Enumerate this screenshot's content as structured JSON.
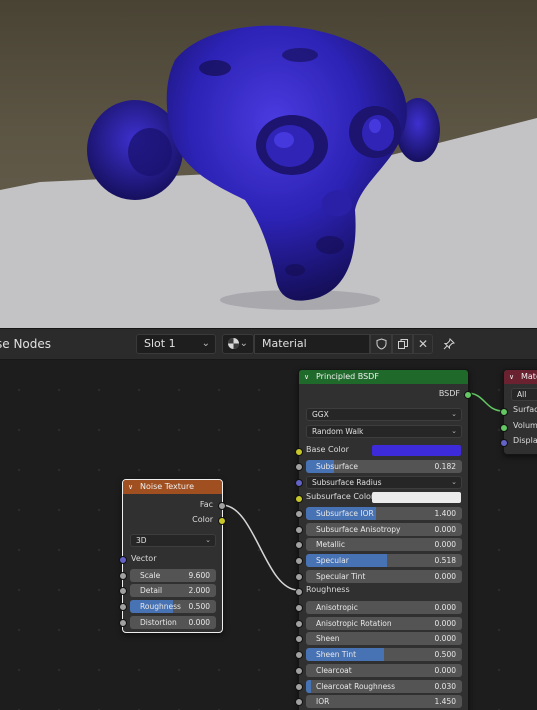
{
  "header": {
    "editor_title": "se Nodes",
    "slot": "Slot 1",
    "material_name": "Material",
    "icons": [
      "material-sphere-icon",
      "shield-icon",
      "duplicate-icon",
      "close-icon",
      "pin-icon"
    ]
  },
  "noise_node": {
    "title": "Noise Texture",
    "outputs": {
      "fac": "Fac",
      "color": "Color"
    },
    "dimensions": "3D",
    "vector_label": "Vector",
    "fields": [
      {
        "label": "Scale",
        "value": "9.600",
        "fill": 0
      },
      {
        "label": "Detail",
        "value": "2.000",
        "fill": 0
      },
      {
        "label": "Roughness",
        "value": "0.500",
        "fill": 0.5
      },
      {
        "label": "Distortion",
        "value": "0.000",
        "fill": 0
      }
    ],
    "header_color": "#a04f20"
  },
  "bsdf_node": {
    "title": "Principled BSDF",
    "output": "BSDF",
    "distribution": "GGX",
    "subsurface_method": "Random Walk",
    "base_color_label": "Base Color",
    "base_color": "#3d2ad8",
    "subsurface": {
      "label": "Subsurface",
      "value": "0.182",
      "fill": 0.182
    },
    "subsurface_radius_label": "Subsurface Radius",
    "subsurface_color_label": "Subsurface Color",
    "subsurface_color": "#ececec",
    "fields": [
      {
        "label": "Subsurface IOR",
        "value": "1.400",
        "fill": 0.45
      },
      {
        "label": "Subsurface Anisotropy",
        "value": "0.000",
        "fill": 0
      },
      {
        "label": "Metallic",
        "value": "0.000",
        "fill": 0
      },
      {
        "label": "Specular",
        "value": "0.518",
        "fill": 0.518
      },
      {
        "label": "Specular Tint",
        "value": "0.000",
        "fill": 0
      }
    ],
    "roughness_label": "Roughness",
    "fields2": [
      {
        "label": "Anisotropic",
        "value": "0.000",
        "fill": 0
      },
      {
        "label": "Anisotropic Rotation",
        "value": "0.000",
        "fill": 0
      },
      {
        "label": "Sheen",
        "value": "0.000",
        "fill": 0
      },
      {
        "label": "Sheen Tint",
        "value": "0.500",
        "fill": 0.5
      },
      {
        "label": "Clearcoat",
        "value": "0.000",
        "fill": 0
      },
      {
        "label": "Clearcoat Roughness",
        "value": "0.030",
        "fill": 0.03
      },
      {
        "label": "IOR",
        "value": "1.450",
        "fill": 0
      }
    ],
    "header_color": "#1f6a2b"
  },
  "output_node": {
    "title": "Mate",
    "target": "All",
    "inputs": [
      "Surface",
      "Volume",
      "Displac"
    ],
    "header_color": "#6b2230"
  },
  "colors": {
    "socket_yellow": "#c7c729",
    "socket_gray": "#a1a1a1",
    "socket_purple": "#6363c7",
    "socket_green": "#63c763",
    "field_fill": "#4772b3"
  }
}
